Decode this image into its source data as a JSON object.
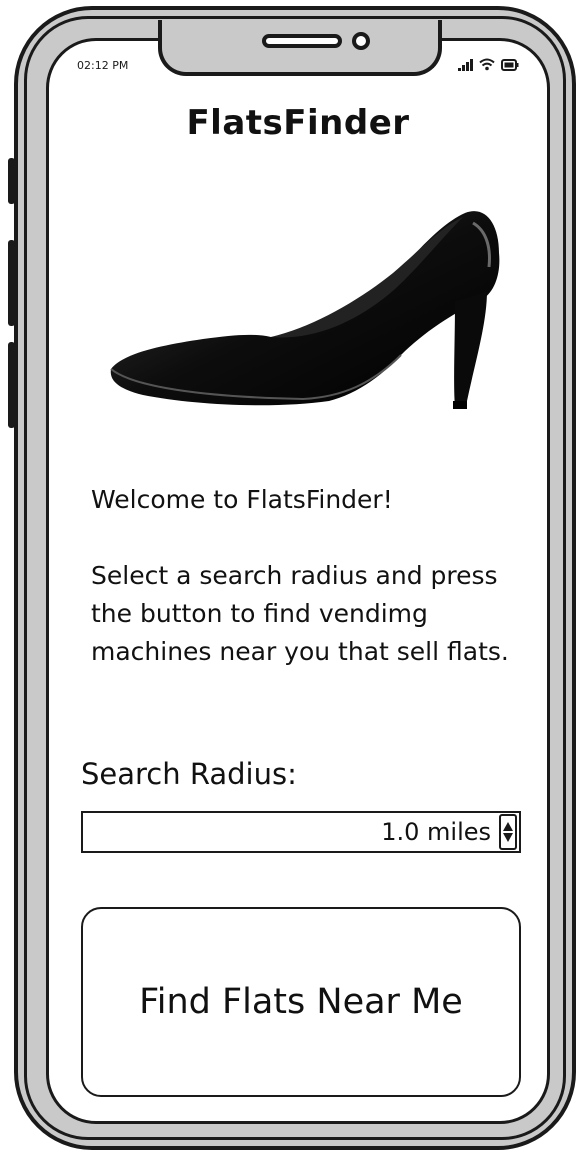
{
  "status_bar": {
    "time": "02:12 PM",
    "icons": [
      "signal-icon",
      "wifi-icon",
      "battery-icon"
    ]
  },
  "app": {
    "title": "FlatsFinder"
  },
  "hero_image": {
    "icon": "high-heel-shoe-image"
  },
  "intro": {
    "welcome": "Welcome to FlatsFinder!",
    "instructions": "Select a search radius and press the button to find vendimg machines near you that sell flats."
  },
  "search_radius": {
    "label": "Search Radius:",
    "value": "1.0 miles"
  },
  "find_button": {
    "label": "Find Flats Near Me"
  },
  "colors": {
    "frame": "#c9c9c9",
    "ink": "#1a1a1a",
    "screen": "#ffffff"
  }
}
